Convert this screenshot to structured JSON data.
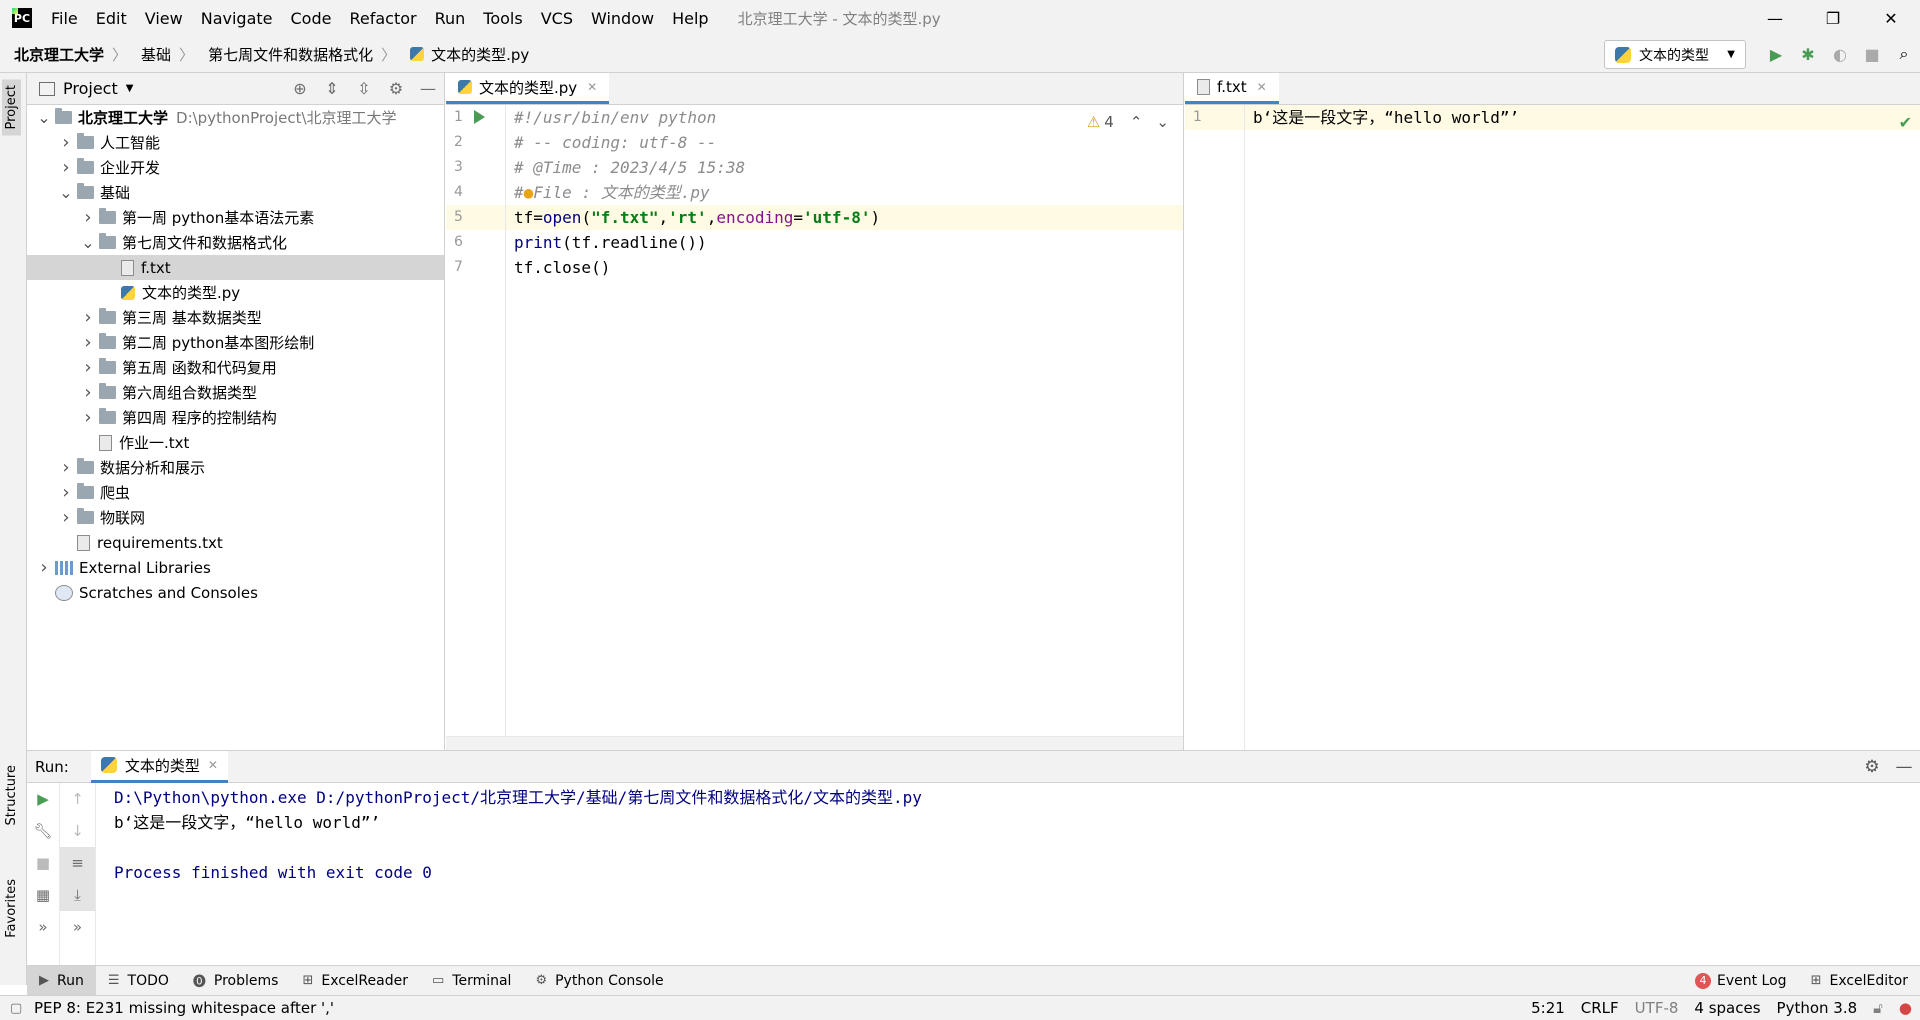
{
  "window": {
    "app_icon": "pycharm-icon",
    "title": "北京理工大学 - 文本的类型.py",
    "menu": [
      "File",
      "Edit",
      "View",
      "Navigate",
      "Code",
      "Refactor",
      "Run",
      "Tools",
      "VCS",
      "Window",
      "Help"
    ],
    "controls": {
      "minimize": "—",
      "restore": "❐",
      "close": "✕"
    }
  },
  "breadcrumbs": [
    "北京理工大学",
    "基础",
    "第七周文件和数据格式化",
    "文本的类型.py"
  ],
  "run_config": {
    "label": "文本的类型"
  },
  "left_strip": {
    "project": "Project",
    "structure": "Structure",
    "favorites": "Favorites"
  },
  "project_panel": {
    "title": "Project",
    "tree": [
      {
        "level": 0,
        "arrow": "v",
        "type": "folder",
        "label": "北京理工大学",
        "hint": "D:\\pythonProject\\北京理工大学",
        "bold": true
      },
      {
        "level": 1,
        "arrow": ">",
        "type": "folder",
        "label": "人工智能"
      },
      {
        "level": 1,
        "arrow": ">",
        "type": "folder",
        "label": "企业开发"
      },
      {
        "level": 1,
        "arrow": "v",
        "type": "folder",
        "label": "基础"
      },
      {
        "level": 2,
        "arrow": ">",
        "type": "folder",
        "label": "第一周 python基本语法元素"
      },
      {
        "level": 2,
        "arrow": "v",
        "type": "folder",
        "label": "第七周文件和数据格式化"
      },
      {
        "level": 3,
        "arrow": "",
        "type": "file",
        "label": "f.txt",
        "selected": true
      },
      {
        "level": 3,
        "arrow": "",
        "type": "py",
        "label": "文本的类型.py"
      },
      {
        "level": 2,
        "arrow": ">",
        "type": "folder",
        "label": "第三周 基本数据类型"
      },
      {
        "level": 2,
        "arrow": ">",
        "type": "folder",
        "label": "第二周 python基本图形绘制"
      },
      {
        "level": 2,
        "arrow": ">",
        "type": "folder",
        "label": "第五周 函数和代码复用"
      },
      {
        "level": 2,
        "arrow": ">",
        "type": "folder",
        "label": "第六周组合数据类型"
      },
      {
        "level": 2,
        "arrow": ">",
        "type": "folder",
        "label": "第四周 程序的控制结构"
      },
      {
        "level": 2,
        "arrow": "",
        "type": "file",
        "label": "作业一.txt"
      },
      {
        "level": 1,
        "arrow": ">",
        "type": "folder",
        "label": "数据分析和展示"
      },
      {
        "level": 1,
        "arrow": ">",
        "type": "folder",
        "label": "爬虫"
      },
      {
        "level": 1,
        "arrow": ">",
        "type": "folder",
        "label": "物联网"
      },
      {
        "level": 1,
        "arrow": "",
        "type": "file",
        "label": "requirements.txt"
      },
      {
        "level": 0,
        "arrow": ">",
        "type": "lib",
        "label": "External Libraries"
      },
      {
        "level": 0,
        "arrow": "",
        "type": "scratch",
        "label": "Scratches and Consoles"
      }
    ]
  },
  "editor1": {
    "tab": "文本的类型.py",
    "warnings": "4",
    "lines": [
      {
        "n": "1",
        "html": "<span class='cmt'>#!/usr/bin/env python</span>"
      },
      {
        "n": "2",
        "html": "<span class='cmt'># -- coding: utf-8 --</span>"
      },
      {
        "n": "3",
        "html": "<span class='cmt'># @Time : 2023/4/5 15:38</span>"
      },
      {
        "n": "4",
        "html": "<span class='cmt'>#<span style='color:#e8a317'>●</span>File : 文本的类型.py</span>"
      },
      {
        "n": "5",
        "html": "tf=<span class='fn'>open</span>(<span class='str'>\"f.txt\"</span>,<span class='str'>'rt'</span>,<span class='kw'>encoding</span>=<span class='str'>'utf-8'</span>)",
        "current": true
      },
      {
        "n": "6",
        "html": "<span class='fn'>print</span>(tf.readline())"
      },
      {
        "n": "7",
        "html": "tf.close()"
      }
    ]
  },
  "editor2": {
    "tab": "f.txt",
    "lines": [
      {
        "n": "1",
        "text": "b‘这是一段文字，“hello world”’"
      }
    ]
  },
  "run_panel": {
    "label": "Run:",
    "tab": "文本的类型",
    "console": [
      {
        "text": "D:\\Python\\python.exe D:/pythonProject/北京理工大学/基础/第七周文件和数据格式化/文本的类型.py",
        "cls": "c-blue"
      },
      {
        "text": "b‘这是一段文字，“hello world”’",
        "cls": ""
      },
      {
        "text": "",
        "cls": ""
      },
      {
        "text": "Process finished with exit code 0",
        "cls": "c-blue"
      }
    ]
  },
  "bottom_tabs": [
    {
      "icon": "▶",
      "label": "Run",
      "active": true
    },
    {
      "icon": "☰",
      "label": "TODO"
    },
    {
      "icon": "⓿",
      "label": "Problems"
    },
    {
      "icon": "⊞",
      "label": "ExcelReader"
    },
    {
      "icon": "▭",
      "label": "Terminal"
    },
    {
      "icon": "⚙",
      "label": "Python Console"
    }
  ],
  "bottom_right": {
    "event_log": "Event Log",
    "event_count": "4",
    "excel_editor": "ExcelEditor"
  },
  "status": {
    "message": "PEP 8: E231 missing whitespace after ','",
    "position": "5:21",
    "line_sep": "CRLF",
    "encoding": "UTF-8",
    "indent": "4 spaces",
    "interpreter": "Python 3.8"
  }
}
